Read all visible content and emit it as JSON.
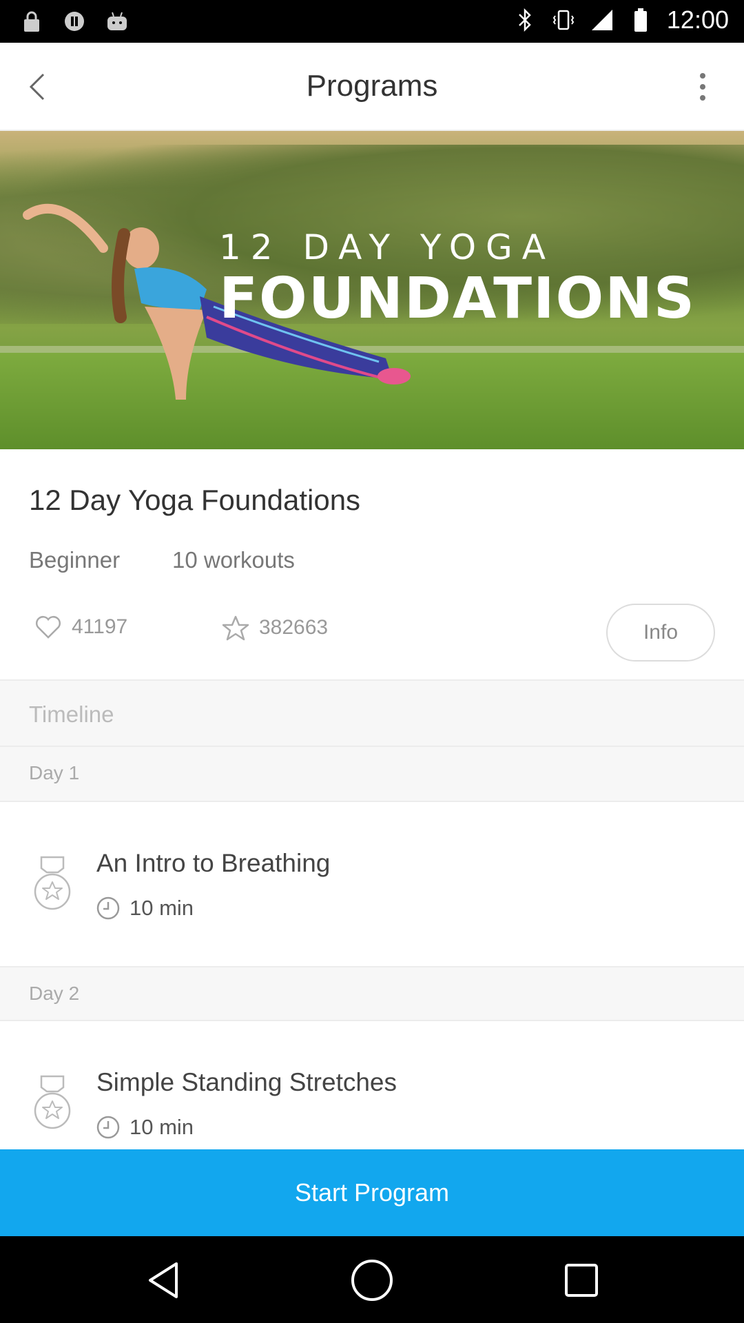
{
  "status_bar": {
    "time": "12:00"
  },
  "appbar": {
    "title": "Programs"
  },
  "hero": {
    "line1": "12 DAY YOGA",
    "line2": "FOUNDATIONS"
  },
  "program": {
    "title": "12 Day Yoga Foundations",
    "level": "Beginner",
    "workouts": "10 workouts",
    "likes": "41197",
    "stars": "382663",
    "info_label": "Info"
  },
  "timeline": {
    "label": "Timeline",
    "days": [
      {
        "label": "Day 1",
        "workout": {
          "title": "An Intro to Breathing",
          "duration": "10 min"
        }
      },
      {
        "label": "Day 2",
        "workout": {
          "title": "Simple Standing Stretches",
          "duration": "10 min"
        }
      }
    ]
  },
  "start_button": {
    "label": "Start Program"
  },
  "colors": {
    "accent": "#12a7ee",
    "text_dark": "#333333",
    "text_muted": "#999999"
  }
}
